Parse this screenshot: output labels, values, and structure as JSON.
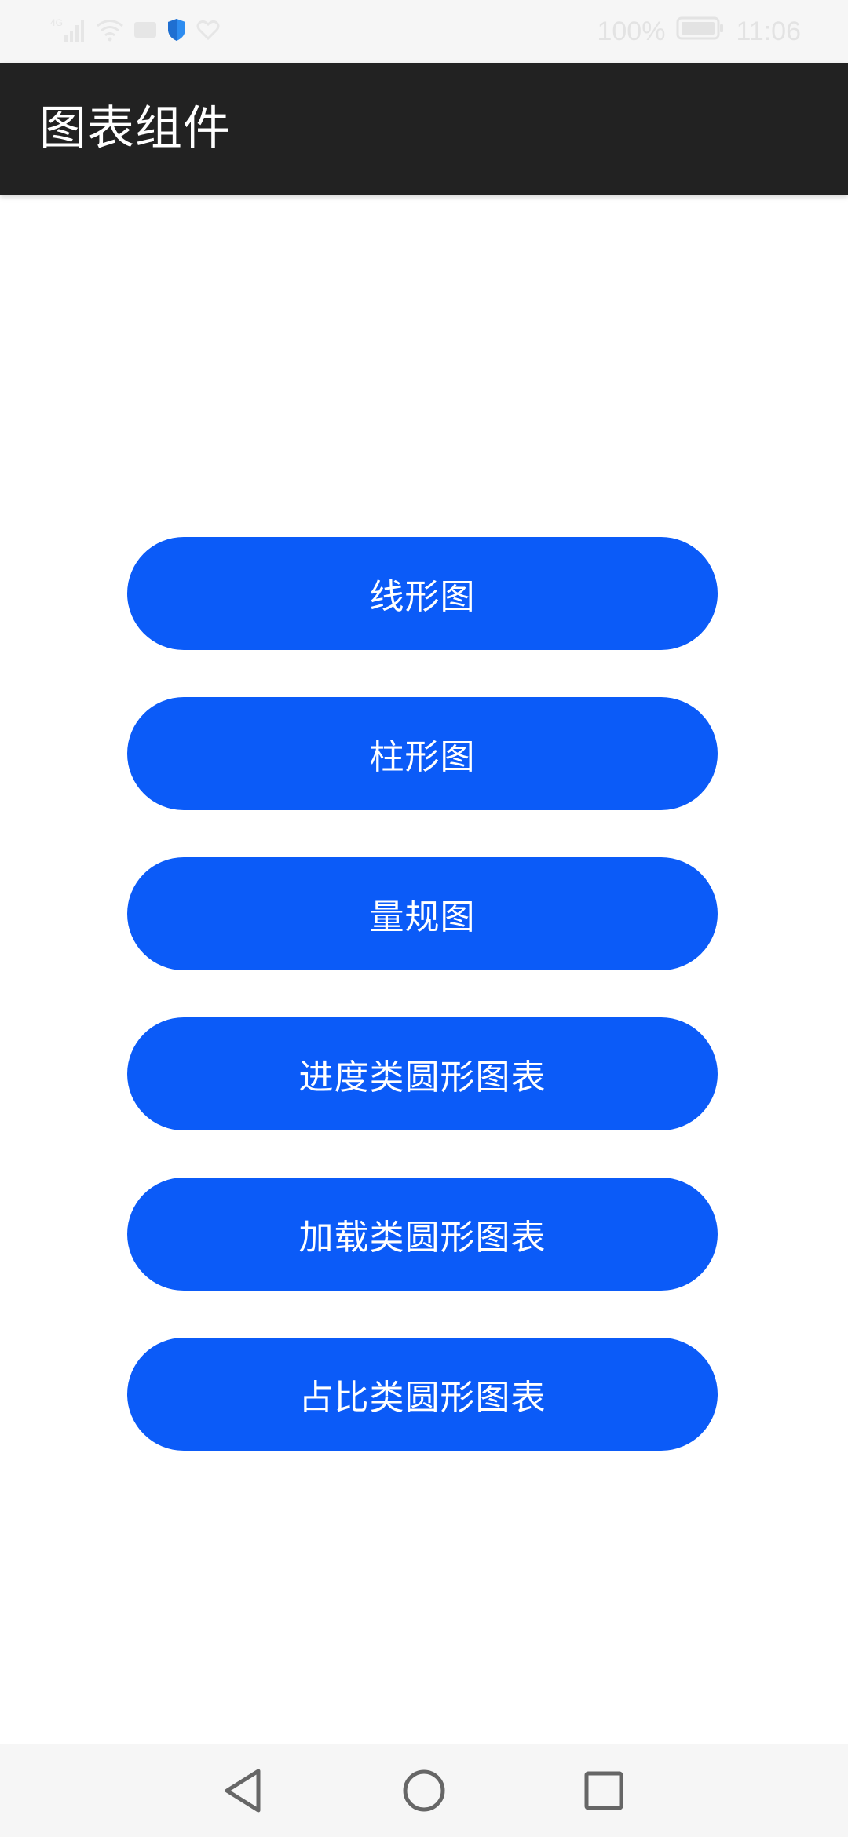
{
  "status_bar": {
    "battery_text": "100%",
    "time": "11:06",
    "icons": [
      "signal-icon",
      "wifi-icon",
      "mail-icon",
      "shield-icon",
      "heart-icon",
      "battery-icon"
    ]
  },
  "app_bar": {
    "title": "图表组件"
  },
  "buttons": [
    {
      "label": "线形图"
    },
    {
      "label": "柱形图"
    },
    {
      "label": "量规图"
    },
    {
      "label": "进度类圆形图表"
    },
    {
      "label": "加载类圆形图表"
    },
    {
      "label": "占比类圆形图表"
    }
  ],
  "colors": {
    "button_bg": "#0b5bf8",
    "app_bar_bg": "#222222",
    "shield_accent": "#2d8cf0"
  },
  "nav_bar": {
    "icons": [
      "back-icon",
      "home-icon",
      "recents-icon"
    ]
  }
}
